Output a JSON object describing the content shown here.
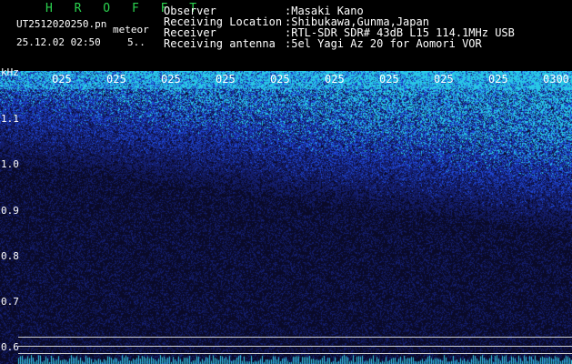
{
  "header": {
    "brand": "H R O F F T",
    "filename": "UT2512020250.pn",
    "meteor_label": "meteor",
    "datetime": "25.12.02 02:50",
    "count": "5..",
    "info": [
      {
        "key": "Observer",
        "value": ":Masaki Kano"
      },
      {
        "key": "Receiving Location",
        "value": ":Shibukawa,Gunma,Japan"
      },
      {
        "key": "Receiver",
        "value": ":RTL-SDR SDR# 43dB L15 114.1MHz USB"
      },
      {
        "key": "Receiving antenna",
        "value": ":5el Yagi Az 20 for Aomori VOR"
      }
    ]
  },
  "axis": {
    "unit": "kHz",
    "y_ticks": [
      "1.1",
      "1.0",
      "0.9",
      "0.8",
      "0.7",
      "0.6"
    ],
    "time_ticks": [
      "025",
      "025",
      "025",
      "025",
      "025",
      "025",
      "025",
      "025",
      "025",
      "0300"
    ]
  },
  "colors": {
    "background": "#000000",
    "spectrum_dark": "#0a0a3a",
    "spectrum_mid": "#1f3fd0",
    "spectrum_hot": "#36d0e8",
    "brand": "#2bd24f"
  }
}
